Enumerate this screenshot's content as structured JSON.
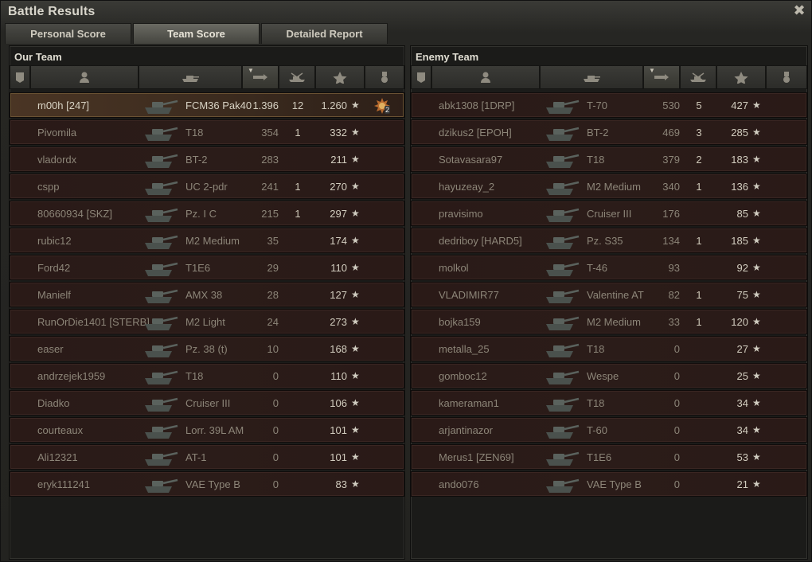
{
  "window": {
    "title": "Battle Results",
    "close_icon": "close-icon"
  },
  "tabs": [
    {
      "label": "Personal Score",
      "active": false
    },
    {
      "label": "Team Score",
      "active": true
    },
    {
      "label": "Detailed Report",
      "active": false
    }
  ],
  "header_icons": [
    "platoon-icon",
    "player-icon",
    "vehicle-icon",
    "damage-icon",
    "kills-icon",
    "xp-star-icon",
    "medal-icon"
  ],
  "our_team": {
    "title": "Our Team",
    "rows": [
      {
        "name": "m00h [247]",
        "vehicle": "FCM36 Pak40",
        "damage": "1.396",
        "kills": "12",
        "xp": "1.260",
        "me": true,
        "medal": true,
        "medal_count": "2"
      },
      {
        "name": "Pivomila",
        "vehicle": "T18",
        "damage": "354",
        "kills": "1",
        "xp": "332"
      },
      {
        "name": "vladordx",
        "vehicle": "BT-2",
        "damage": "283",
        "kills": "",
        "xp": "211"
      },
      {
        "name": "cspp",
        "vehicle": "UC 2-pdr",
        "damage": "241",
        "kills": "1",
        "xp": "270"
      },
      {
        "name": "80660934 [SKZ]",
        "vehicle": "Pz. I C",
        "damage": "215",
        "kills": "1",
        "xp": "297"
      },
      {
        "name": "rubic12",
        "vehicle": "M2 Medium",
        "damage": "35",
        "kills": "",
        "xp": "174"
      },
      {
        "name": "Ford42",
        "vehicle": "T1E6",
        "damage": "29",
        "kills": "",
        "xp": "110"
      },
      {
        "name": "Manielf",
        "vehicle": "AMX 38",
        "damage": "28",
        "kills": "",
        "xp": "127"
      },
      {
        "name": "RunOrDie1401 [STERB]",
        "vehicle": "M2 Light",
        "damage": "24",
        "kills": "",
        "xp": "273"
      },
      {
        "name": "easer",
        "vehicle": "Pz. 38 (t)",
        "damage": "10",
        "kills": "",
        "xp": "168"
      },
      {
        "name": "andrzejek1959",
        "vehicle": "T18",
        "damage": "0",
        "kills": "",
        "xp": "110"
      },
      {
        "name": "Diadko",
        "vehicle": "Cruiser III",
        "damage": "0",
        "kills": "",
        "xp": "106"
      },
      {
        "name": "courteaux",
        "vehicle": "Lorr. 39L AM",
        "damage": "0",
        "kills": "",
        "xp": "101"
      },
      {
        "name": "Ali12321",
        "vehicle": "AT-1",
        "damage": "0",
        "kills": "",
        "xp": "101"
      },
      {
        "name": "eryk111241",
        "vehicle": "VAE Type B",
        "damage": "0",
        "kills": "",
        "xp": "83"
      }
    ]
  },
  "enemy_team": {
    "title": "Enemy Team",
    "rows": [
      {
        "name": "abk1308 [1DRP]",
        "vehicle": "T-70",
        "damage": "530",
        "kills": "5",
        "xp": "427"
      },
      {
        "name": "dzikus2 [EPOH]",
        "vehicle": "BT-2",
        "damage": "469",
        "kills": "3",
        "xp": "285"
      },
      {
        "name": "Sotavasara97",
        "vehicle": "T18",
        "damage": "379",
        "kills": "2",
        "xp": "183"
      },
      {
        "name": "hayuzeay_2",
        "vehicle": "M2 Medium",
        "damage": "340",
        "kills": "1",
        "xp": "136"
      },
      {
        "name": "pravisimo",
        "vehicle": "Cruiser III",
        "damage": "176",
        "kills": "",
        "xp": "85"
      },
      {
        "name": "dedriboy [HARD5]",
        "vehicle": "Pz. S35",
        "damage": "134",
        "kills": "1",
        "xp": "185"
      },
      {
        "name": "molkol",
        "vehicle": "T-46",
        "damage": "93",
        "kills": "",
        "xp": "92"
      },
      {
        "name": "VLADIMIR77",
        "vehicle": "Valentine AT",
        "damage": "82",
        "kills": "1",
        "xp": "75"
      },
      {
        "name": "bojka159",
        "vehicle": "M2 Medium",
        "damage": "33",
        "kills": "1",
        "xp": "120"
      },
      {
        "name": "metalla_25",
        "vehicle": "T18",
        "damage": "0",
        "kills": "",
        "xp": "27"
      },
      {
        "name": "gomboc12",
        "vehicle": "Wespe",
        "damage": "0",
        "kills": "",
        "xp": "25"
      },
      {
        "name": "kameraman1",
        "vehicle": "T18",
        "damage": "0",
        "kills": "",
        "xp": "34"
      },
      {
        "name": "arjantinazor",
        "vehicle": "T-60",
        "damage": "0",
        "kills": "",
        "xp": "34"
      },
      {
        "name": "Merus1 [ZEN69]",
        "vehicle": "T1E6",
        "damage": "0",
        "kills": "",
        "xp": "53"
      },
      {
        "name": "ando076",
        "vehicle": "VAE Type B",
        "damage": "0",
        "kills": "",
        "xp": "21"
      }
    ]
  },
  "star_glyph": "★",
  "close_glyph": "✖"
}
